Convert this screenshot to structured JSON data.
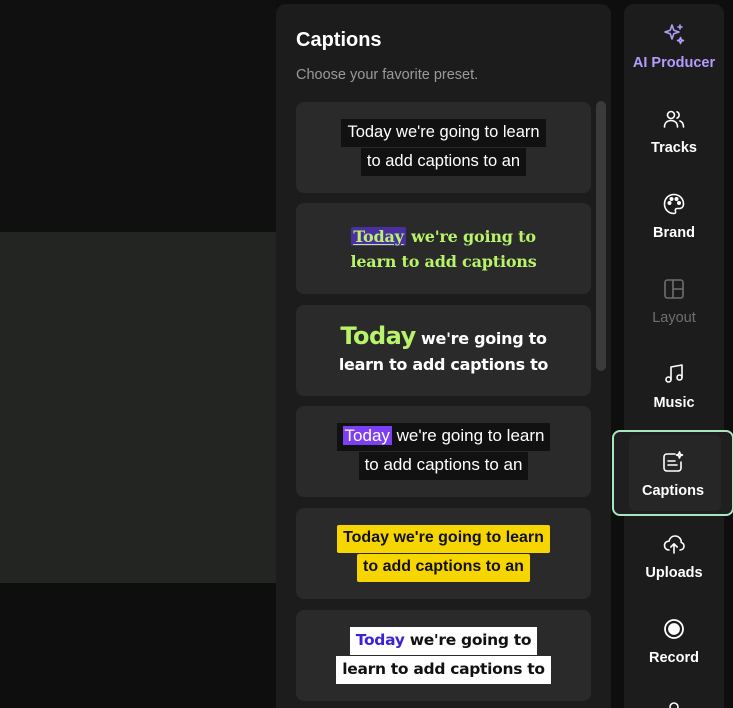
{
  "panel": {
    "title": "Captions",
    "subtitle": "Choose your favorite preset."
  },
  "presets": [
    {
      "lines": [
        "Today we're going to learn",
        "to add captions to an"
      ]
    },
    {
      "highlight": "Today",
      "line1_rest": " we're going to",
      "line2": "learn to add captions"
    },
    {
      "big": "Today",
      "line1_rest": " we're going to",
      "line2": "learn to add captions to"
    },
    {
      "highlight": "Today",
      "line1_rest": " we're going to learn",
      "line2": "to add captions to an"
    },
    {
      "lines": [
        "Today we're going to learn",
        "to add captions to an"
      ]
    },
    {
      "highlight": "Today",
      "line1_rest": " we're going to",
      "line2": "learn to add captions to"
    }
  ],
  "rail": {
    "items": [
      {
        "label": "AI Producer",
        "icon": "sparkles-icon"
      },
      {
        "label": "Tracks",
        "icon": "users-icon"
      },
      {
        "label": "Brand",
        "icon": "palette-icon"
      },
      {
        "label": "Layout",
        "icon": "layout-icon"
      },
      {
        "label": "Music",
        "icon": "music-icon"
      },
      {
        "label": "Captions",
        "icon": "captions-icon"
      },
      {
        "label": "Uploads",
        "icon": "cloud-upload-icon"
      },
      {
        "label": "Record",
        "icon": "record-icon"
      }
    ]
  },
  "colors": {
    "accent_purple": "#b49cff",
    "selected_border": "#a8e6c0",
    "lime": "#b8f36a",
    "yellow": "#f7d600",
    "violet": "#7d3ff2"
  }
}
